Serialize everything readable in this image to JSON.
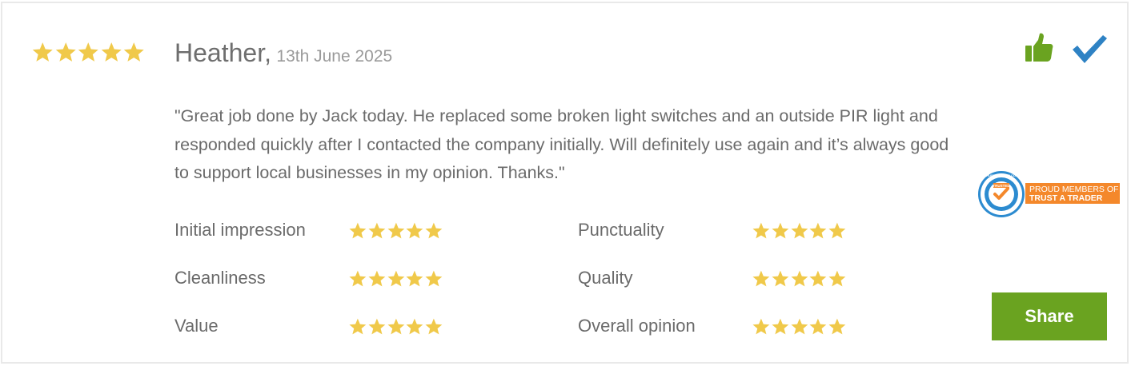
{
  "review": {
    "reviewer": "Heather,",
    "date": "13th June 2025",
    "overall_rating": 5,
    "text": "\"Great job done by Jack today. He replaced some broken light switches and an outside PIR light and responded quickly after I contacted the company initially. Will definitely use again and it’s always good to support local businesses in my opinion. Thanks.\""
  },
  "ratings": [
    {
      "label": "Initial impression",
      "stars": 5
    },
    {
      "label": "Punctuality",
      "stars": 5
    },
    {
      "label": "Cleanliness",
      "stars": 5
    },
    {
      "label": "Quality",
      "stars": 5
    },
    {
      "label": "Value",
      "stars": 5
    },
    {
      "label": "Overall opinion",
      "stars": 5
    }
  ],
  "icons": {
    "thumb": "thumbs-up-icon",
    "check": "checkmark-icon",
    "star": "star-icon"
  },
  "badge": {
    "ring_text": "TRUSTATRADER.COM",
    "center_text": "TRUSTED",
    "line1": "PROUD MEMBERS OF",
    "line2": "TRUST A TRADER"
  },
  "share_label": "Share",
  "colors": {
    "star": "#f0c94a",
    "thumb": "#6aa320",
    "check": "#2e82c4",
    "share_bg": "#6aa320",
    "badge_orange": "#f4882b",
    "badge_blue": "#2c8bd0"
  }
}
